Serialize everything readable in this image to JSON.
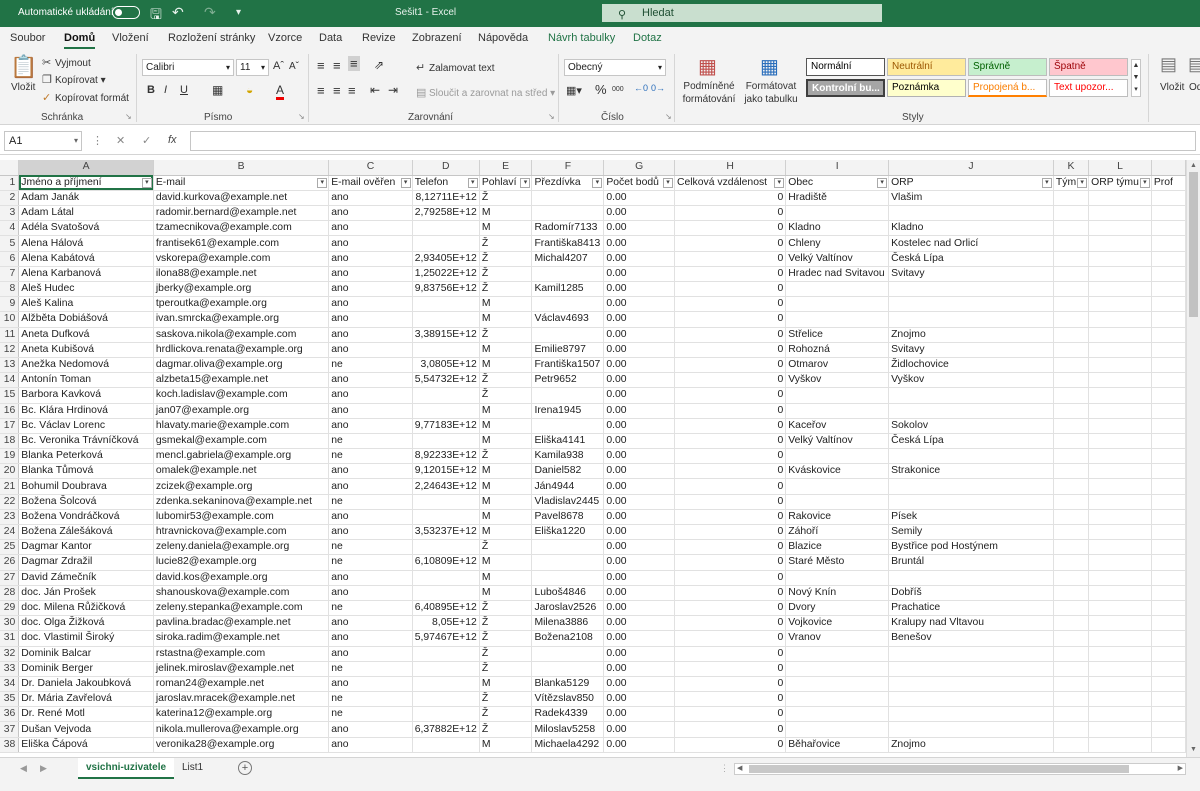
{
  "titlebar": {
    "autosave_label": "Automatické ukládání",
    "workbook_title": "Sešit1 - Excel",
    "search_placeholder": "Hledat",
    "brand_color": "#217346"
  },
  "menu": {
    "tabs": [
      "Soubor",
      "Domů",
      "Vložení",
      "Rozložení stránky",
      "Vzorce",
      "Data",
      "Revize",
      "Zobrazení",
      "Nápověda",
      "Návrh tabulky",
      "Dotaz"
    ],
    "active": "Domů"
  },
  "ribbon": {
    "clipboard": {
      "paste": "Vložit",
      "cut": "Vyjmout",
      "copy": "Kopírovat",
      "format_painter": "Kopírovat formát",
      "label": "Schránka"
    },
    "font": {
      "name": "Calibri",
      "size": "11",
      "bold": "B",
      "italic": "I",
      "underline": "U",
      "label": "Písmo"
    },
    "alignment": {
      "wrap": "Zalamovat text",
      "merge": "Sloučit a zarovnat na střed",
      "label": "Zarovnání"
    },
    "number": {
      "format": "Obecný",
      "label": "Číslo"
    },
    "styles": {
      "conditional": "Podmíněné formátování",
      "as_table": "Formátovat jako tabulku",
      "cells": [
        {
          "name": "Normální",
          "bg": "#ffffff",
          "color": "#000000"
        },
        {
          "name": "Neutrální",
          "bg": "#ffeb9c",
          "color": "#9c5700"
        },
        {
          "name": "Správně",
          "bg": "#c6efce",
          "color": "#006100"
        },
        {
          "name": "Špatně",
          "bg": "#ffc7ce",
          "color": "#9c0006"
        },
        {
          "name": "Kontrolní bu...",
          "bg": "#a5a5a5",
          "color": "#ffffff"
        },
        {
          "name": "Poznámka",
          "bg": "#ffffcc",
          "color": "#000000"
        },
        {
          "name": "Propojená b...",
          "bg": "#ffffff",
          "color": "#fa7d00"
        },
        {
          "name": "Text upozor...",
          "bg": "#ffffff",
          "color": "#ff0000"
        }
      ],
      "label": "Styly"
    },
    "cells_group": {
      "insert": "Vložit",
      "other": "Od"
    }
  },
  "formula_bar": {
    "name_box": "A1",
    "fx": "fx",
    "value": ""
  },
  "columns": [
    "A",
    "B",
    "C",
    "D",
    "E",
    "F",
    "G",
    "H",
    "I",
    "J",
    "K",
    "L"
  ],
  "headers": [
    "Jméno a příjmení",
    "E-mail",
    "E-mail ověřen",
    "Telefon",
    "Pohlaví",
    "Přezdívka",
    "Počet bodů",
    "Celková vzdálenost",
    "Obec",
    "ORP",
    "Tým",
    "ORP týmu",
    "Prof"
  ],
  "rows": [
    [
      "Adam Janák",
      "david.kurkova@example.net",
      "ano",
      "8,12711E+12",
      "Ž",
      "",
      "0.00",
      "0",
      "Hradiště",
      "Vlašim"
    ],
    [
      "Adam Látal",
      "radomir.bernard@example.net",
      "ano",
      "2,79258E+12",
      "M",
      "",
      "0.00",
      "0",
      "",
      ""
    ],
    [
      "Adéla Svatošová",
      "tzamecnikova@example.com",
      "ano",
      "",
      "M",
      "Radomír7133",
      "0.00",
      "0",
      "Kladno",
      "Kladno"
    ],
    [
      "Alena Hálová",
      "frantisek61@example.com",
      "ano",
      "",
      "Ž",
      "Františka8413",
      "0.00",
      "0",
      "Chleny",
      "Kostelec nad Orlicí"
    ],
    [
      "Alena Kabátová",
      "vskorepa@example.com",
      "ano",
      "2,93405E+12",
      "Ž",
      "Michal4207",
      "0.00",
      "0",
      "Velký Valtínov",
      "Česká Lípa"
    ],
    [
      "Alena Karbanová",
      "ilona88@example.net",
      "ano",
      "1,25022E+12",
      "Ž",
      "",
      "0.00",
      "0",
      "Hradec nad Svitavou",
      "Svitavy"
    ],
    [
      "Aleš Hudec",
      "jberky@example.org",
      "ano",
      "9,83756E+12",
      "Ž",
      "Kamil1285",
      "0.00",
      "0",
      "",
      ""
    ],
    [
      "Aleš Kalina",
      "tperoutka@example.org",
      "ano",
      "",
      "M",
      "",
      "0.00",
      "0",
      "",
      ""
    ],
    [
      "Alžběta Dobiášová",
      "ivan.smrcka@example.org",
      "ano",
      "",
      "M",
      "Václav4693",
      "0.00",
      "0",
      "",
      ""
    ],
    [
      "Aneta Dufková",
      "saskova.nikola@example.com",
      "ano",
      "3,38915E+12",
      "Ž",
      "",
      "0.00",
      "0",
      "Střelice",
      "Znojmo"
    ],
    [
      "Aneta Kubišová",
      "hrdlickova.renata@example.org",
      "ano",
      "",
      "M",
      "Emilie8797",
      "0.00",
      "0",
      "Rohozná",
      "Svitavy"
    ],
    [
      "Anežka Nedomová",
      "dagmar.oliva@example.org",
      "ne",
      "3,0805E+12",
      "M",
      "Františka1507",
      "0.00",
      "0",
      "Otmarov",
      "Židlochovice"
    ],
    [
      "Antonín Toman",
      "alzbeta15@example.net",
      "ano",
      "5,54732E+12",
      "Ž",
      "Petr9652",
      "0.00",
      "0",
      "Vyškov",
      "Vyškov"
    ],
    [
      "Barbora Kavková",
      "koch.ladislav@example.com",
      "ano",
      "",
      "Ž",
      "",
      "0.00",
      "0",
      "",
      ""
    ],
    [
      "Bc. Klára Hrdinová",
      "jan07@example.org",
      "ano",
      "",
      "M",
      "Irena1945",
      "0.00",
      "0",
      "",
      ""
    ],
    [
      "Bc. Václav Lorenc",
      "hlavaty.marie@example.com",
      "ano",
      "9,77183E+12",
      "M",
      "",
      "0.00",
      "0",
      "Kaceřov",
      "Sokolov"
    ],
    [
      "Bc. Veronika Trávníčková",
      "gsmekal@example.com",
      "ne",
      "",
      "M",
      "Eliška4141",
      "0.00",
      "0",
      "Velký Valtínov",
      "Česká Lípa"
    ],
    [
      "Blanka Peterková",
      "mencl.gabriela@example.org",
      "ne",
      "8,92233E+12",
      "Ž",
      "Kamila938",
      "0.00",
      "0",
      "",
      ""
    ],
    [
      "Blanka Tůmová",
      "omalek@example.net",
      "ano",
      "9,12015E+12",
      "M",
      "Daniel582",
      "0.00",
      "0",
      "Kváskovice",
      "Strakonice"
    ],
    [
      "Bohumil Doubrava",
      "zcizek@example.org",
      "ano",
      "2,24643E+12",
      "M",
      "Ján4944",
      "0.00",
      "0",
      "",
      ""
    ],
    [
      "Božena Šolcová",
      "zdenka.sekaninova@example.net",
      "ne",
      "",
      "M",
      "Vladislav2445",
      "0.00",
      "0",
      "",
      ""
    ],
    [
      "Božena Vondráčková",
      "lubomir53@example.com",
      "ano",
      "",
      "M",
      "Pavel8678",
      "0.00",
      "0",
      "Rakovice",
      "Písek"
    ],
    [
      "Božena Zálešáková",
      "htravnickova@example.com",
      "ano",
      "3,53237E+12",
      "M",
      "Eliška1220",
      "0.00",
      "0",
      "Záhoří",
      "Semily"
    ],
    [
      "Dagmar Kantor",
      "zeleny.daniela@example.org",
      "ne",
      "",
      "Ž",
      "",
      "0.00",
      "0",
      "Blazice",
      "Bystřice pod Hostýnem"
    ],
    [
      "Dagmar Zdražil",
      "lucie82@example.org",
      "ne",
      "6,10809E+12",
      "M",
      "",
      "0.00",
      "0",
      "Staré Město",
      "Bruntál"
    ],
    [
      "David Zámečník",
      "david.kos@example.org",
      "ano",
      "",
      "M",
      "",
      "0.00",
      "0",
      "",
      ""
    ],
    [
      "doc. Ján Prošek",
      "shanouskova@example.com",
      "ano",
      "",
      "M",
      "Luboš4846",
      "0.00",
      "0",
      "Nový Knín",
      "Dobříš"
    ],
    [
      "doc. Milena Růžičková",
      "zeleny.stepanka@example.com",
      "ne",
      "6,40895E+12",
      "Ž",
      "Jaroslav2526",
      "0.00",
      "0",
      "Dvory",
      "Prachatice"
    ],
    [
      "doc. Olga Žižková",
      "pavlina.bradac@example.net",
      "ano",
      "8,05E+12",
      "Ž",
      "Milena3886",
      "0.00",
      "0",
      "Vojkovice",
      "Kralupy nad Vltavou"
    ],
    [
      "doc. Vlastimil Široký",
      "siroka.radim@example.net",
      "ano",
      "5,97467E+12",
      "Ž",
      "Božena2108",
      "0.00",
      "0",
      "Vranov",
      "Benešov"
    ],
    [
      "Dominik Balcar",
      "rstastna@example.com",
      "ano",
      "",
      "Ž",
      "",
      "0.00",
      "0",
      "",
      ""
    ],
    [
      "Dominik Berger",
      "jelinek.miroslav@example.net",
      "ne",
      "",
      "Ž",
      "",
      "0.00",
      "0",
      "",
      ""
    ],
    [
      "Dr. Daniela Jakoubková",
      "roman24@example.net",
      "ano",
      "",
      "M",
      "Blanka5129",
      "0.00",
      "0",
      "",
      ""
    ],
    [
      "Dr. Mária Zavřelová",
      "jaroslav.mracek@example.net",
      "ne",
      "",
      "Ž",
      "Vítězslav850",
      "0.00",
      "0",
      "",
      ""
    ],
    [
      "Dr. René Motl",
      "katerina12@example.org",
      "ne",
      "",
      "Ž",
      "Radek4339",
      "0.00",
      "0",
      "",
      ""
    ],
    [
      "Dušan Vejvoda",
      "nikola.mullerova@example.org",
      "ano",
      "6,37882E+12",
      "Ž",
      "Miloslav5258",
      "0.00",
      "0",
      "",
      ""
    ],
    [
      "Eliška Čápová",
      "veronika28@example.org",
      "ano",
      "",
      "M",
      "Michaela4292",
      "0.00",
      "0",
      "Běhařovice",
      "Znojmo"
    ]
  ],
  "sheets": {
    "tabs": [
      "vsichni-uzivatele",
      "List1"
    ],
    "active": "vsichni-uzivatele"
  }
}
